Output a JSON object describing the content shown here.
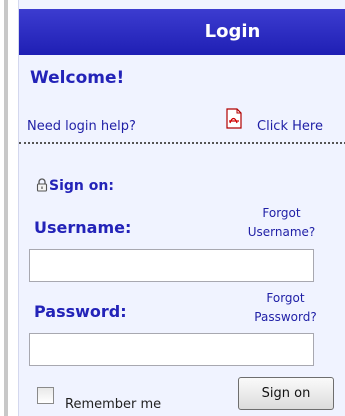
{
  "header": {
    "title": "Login"
  },
  "welcome": {
    "text": "Welcome!"
  },
  "help": {
    "prompt": "Need login help?",
    "link_label": "Click Here",
    "pdf_icon": "pdf-file-icon"
  },
  "sign_on": {
    "heading": "Sign on:",
    "lock_icon": "lock-icon"
  },
  "username": {
    "label": "Username:",
    "forgot_line1": "Forgot",
    "forgot_line2": "Username?",
    "value": "",
    "placeholder": ""
  },
  "password": {
    "label": "Password:",
    "forgot_line1": "Forgot",
    "forgot_line2": "Password?",
    "value": "",
    "placeholder": ""
  },
  "remember": {
    "label": "Remember me",
    "checked": false
  },
  "submit": {
    "label": "Sign on"
  },
  "colors": {
    "header_bg": "#2a2ac4",
    "accent_text": "#2323b8",
    "panel_bg": "#f0f3ff"
  }
}
